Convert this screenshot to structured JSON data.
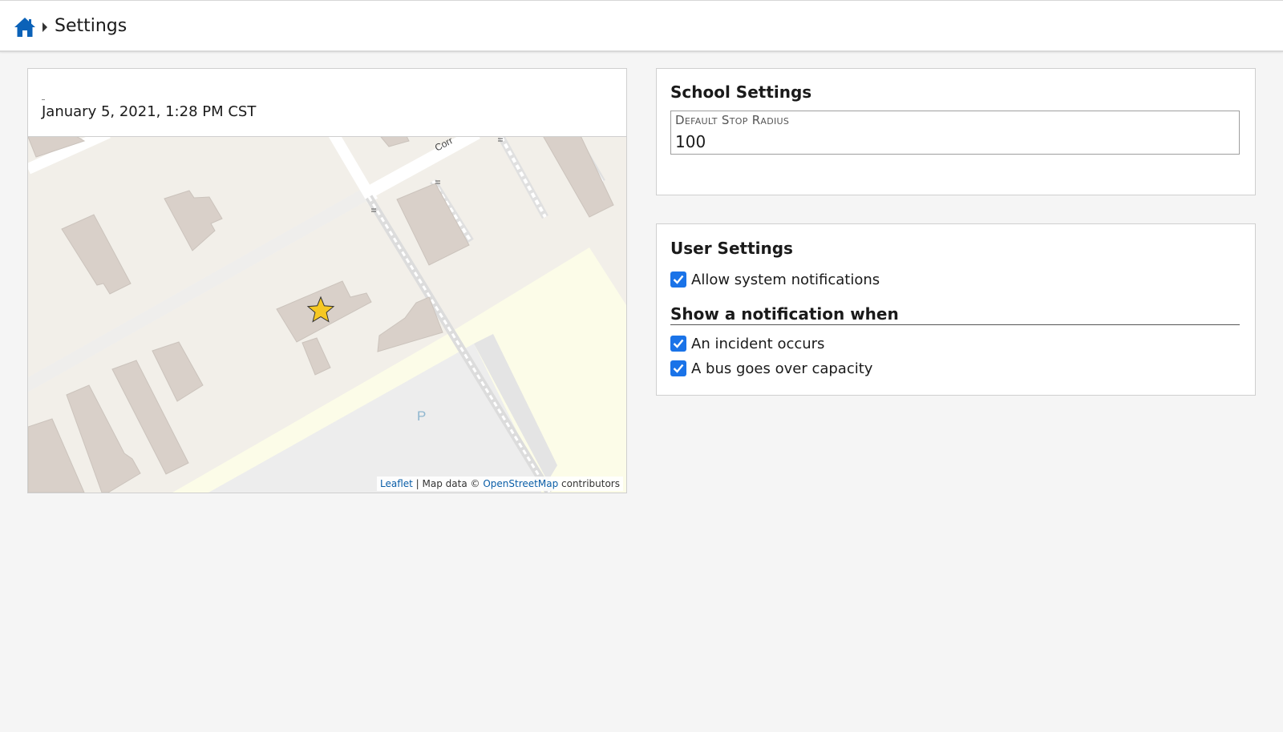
{
  "header": {
    "home_icon": "home-icon",
    "caret_icon": "caret-right-icon",
    "title": "Settings",
    "accent_color": "#0b62b8"
  },
  "map_panel": {
    "timestamp": "January 5, 2021, 1:28 PM CST",
    "marker_icon": "star-icon",
    "street_label": "Corr",
    "parking_label": "P",
    "attribution": {
      "leaflet": "Leaflet",
      "separator": "| Map data ©",
      "osm": "OpenStreetMap",
      "suffix": "contributors"
    }
  },
  "school_settings": {
    "title": "School Settings",
    "default_stop_radius": {
      "label": "Default Stop Radius",
      "value": "100"
    }
  },
  "user_settings": {
    "title": "User Settings",
    "allow_notifications": {
      "label": "Allow system notifications",
      "checked": true
    },
    "notification_heading": "Show a notification when",
    "options": [
      {
        "label": "An incident occurs",
        "checked": true
      },
      {
        "label": "A bus goes over capacity",
        "checked": true
      }
    ],
    "checkbox_color": "#1a73e8"
  }
}
